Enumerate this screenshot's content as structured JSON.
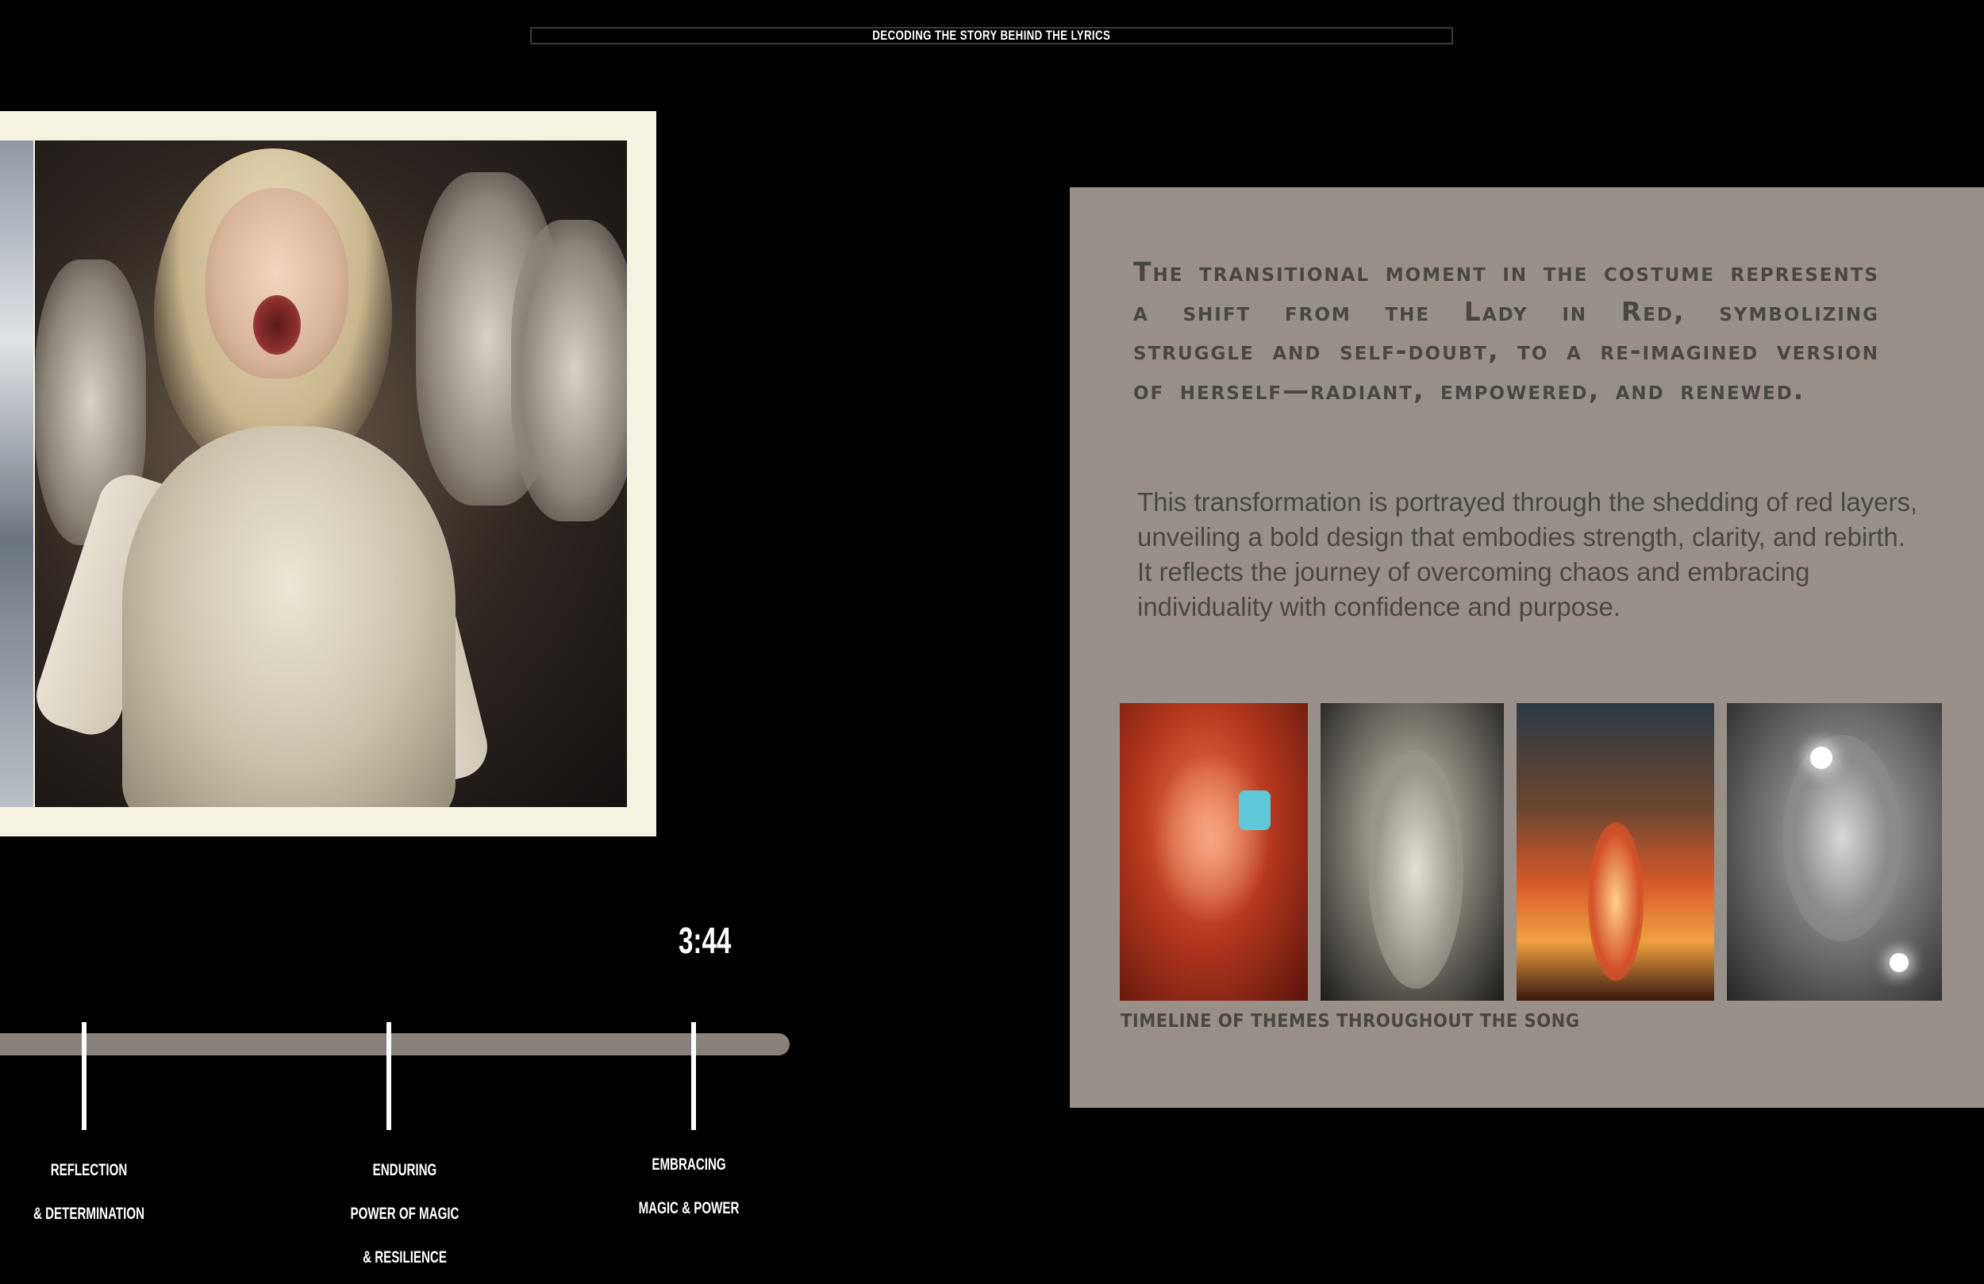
{
  "header": {
    "title": "DECODING THE STORY BEHIND THE LYRICS"
  },
  "player": {
    "timestamp": "3:44"
  },
  "timeline": {
    "markers": [
      {
        "lines": [
          "REFLECTION",
          "& DETERMINATION"
        ]
      },
      {
        "lines": [
          "ENDURING",
          "POWER OF MAGIC",
          "& RESILIENCE"
        ]
      },
      {
        "lines": [
          "EMBRACING",
          "MAGIC & POWER"
        ]
      }
    ]
  },
  "panel": {
    "heading": "The transitional moment in the costume represents a shift from the Lady in Red, symbolizing struggle and self-doubt, to a re-imagined version of herself—radiant, empowered, and renewed.",
    "body": "This transformation is portrayed through the shedding of red layers, unveiling a bold design that embodies strength, clarity, and rebirth. It reflects the journey of overcoming chaos and embracing individuality with confidence and purpose.",
    "caption": "TIMELINE OF THEMES THROUGHOUT THE SONG"
  },
  "colors": {
    "background": "#000000",
    "panel": "#989088",
    "panel_text": "#4a4743",
    "frame": "#f6f2e2",
    "track": "#8a807a"
  }
}
